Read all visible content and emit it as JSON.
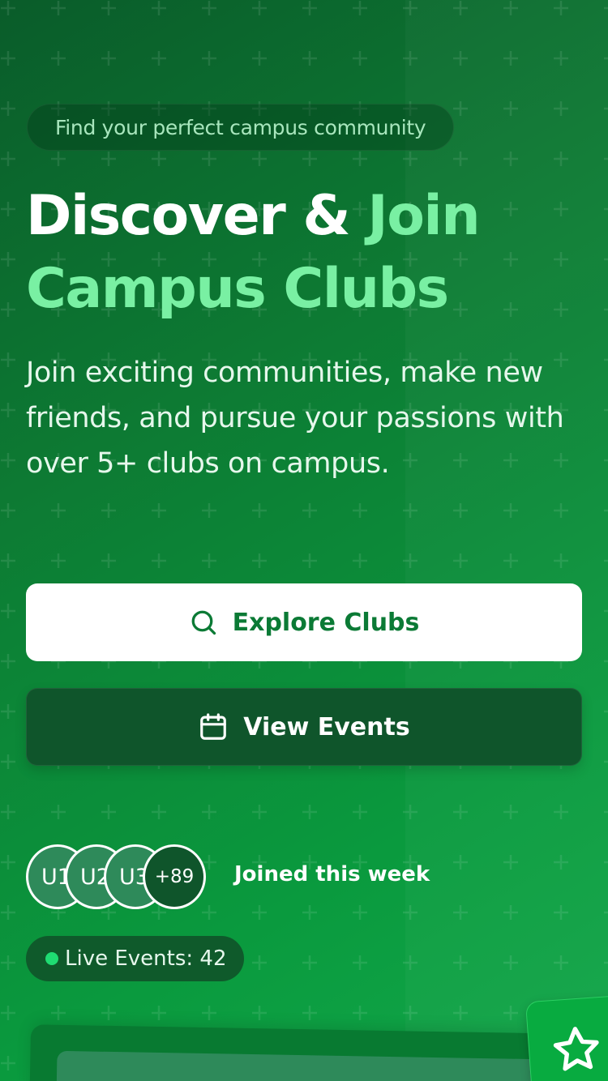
{
  "hero": {
    "tagline": "Find your perfect campus community",
    "title_part1": "Discover & ",
    "title_accent": "Join Campus Clubs",
    "description": "Join exciting communities, make new friends, and pursue your passions with over 5+ clubs on campus."
  },
  "actions": {
    "explore": {
      "label": "Explore Clubs",
      "icon": "search-icon"
    },
    "events": {
      "label": "View Events",
      "icon": "calendar-icon"
    }
  },
  "social_proof": {
    "avatars": [
      "U1",
      "U2",
      "U3"
    ],
    "more_count": "+89",
    "label": "Joined this week"
  },
  "live": {
    "label": "Live Events: 42",
    "indicator_color": "#1fdc72"
  },
  "floating_badge": {
    "icon": "star-icon"
  },
  "colors": {
    "accent": "#79f0a3",
    "brand_green": "#0b7a35",
    "dark_green": "#0f552b"
  }
}
